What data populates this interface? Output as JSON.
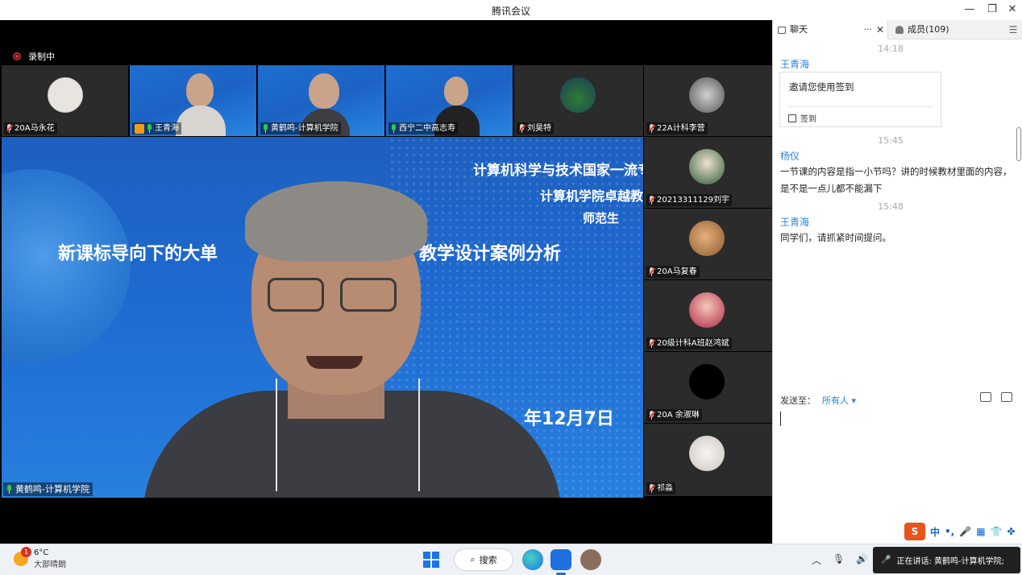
{
  "window": {
    "title": "腾讯会议"
  },
  "meeting": {
    "recording_label": "录制中",
    "top_row": [
      {
        "name": "20A马永花",
        "mic": "off"
      },
      {
        "name": "王青海",
        "mic": "on",
        "host": true
      },
      {
        "name": "黄鹤鸣-计算机学院",
        "mic": "on"
      },
      {
        "name": "西宁二中高志寿",
        "mic": "on"
      },
      {
        "name": "刘昊特",
        "mic": "off"
      },
      {
        "name": "22A计科李营",
        "mic": "off"
      }
    ],
    "side_column": [
      {
        "name": "20213311129刘宇",
        "mic": "off"
      },
      {
        "name": "20A马复春",
        "mic": "off"
      },
      {
        "name": "20级计科A班赵鸿斌",
        "mic": "off"
      },
      {
        "name": "20A 余淑琳",
        "mic": "off"
      },
      {
        "name": "祁淼",
        "mic": "off"
      }
    ],
    "main_speaker": {
      "name": "黄鹤鸣-计算机学院",
      "slide_line1": "计算机科学与技术国家一流专",
      "slide_line2": "计算机学院卓越教",
      "slide_line3": "师范生",
      "slide_title_left": "新课标导向下的大单",
      "slide_title_right": "教学设计案例分析",
      "slide_date": "年12月7日"
    }
  },
  "panel": {
    "tabs": {
      "chat": "聊天",
      "members": "成员(109)"
    },
    "chat": [
      {
        "type": "time",
        "text": "14:18"
      },
      {
        "type": "sender",
        "text": "王青海"
      },
      {
        "type": "card",
        "text": "邀请您使用签到",
        "action": "签到"
      },
      {
        "type": "time",
        "text": "15:45"
      },
      {
        "type": "sender",
        "text": "杨仪"
      },
      {
        "type": "message",
        "text": "一节课的内容是指一小节吗？讲的时候教材里面的内容，是不是一点儿都不能漏下"
      },
      {
        "type": "time",
        "text": "15:48"
      },
      {
        "type": "sender",
        "text": "王青海"
      },
      {
        "type": "message",
        "text": "同学们，请抓紧时间提问。"
      }
    ],
    "send_to_label": "发送至：",
    "send_to_value": "所有人",
    "ime": {
      "logo": "S",
      "mode": "中",
      "punct": "•,"
    }
  },
  "taskbar": {
    "weather_temp": "6°C",
    "weather_desc": "大部晴朗",
    "weather_badge": "1",
    "search_label": "搜索",
    "speaking_text": "正在讲话: 黄鹤鸣-计算机学院;"
  }
}
